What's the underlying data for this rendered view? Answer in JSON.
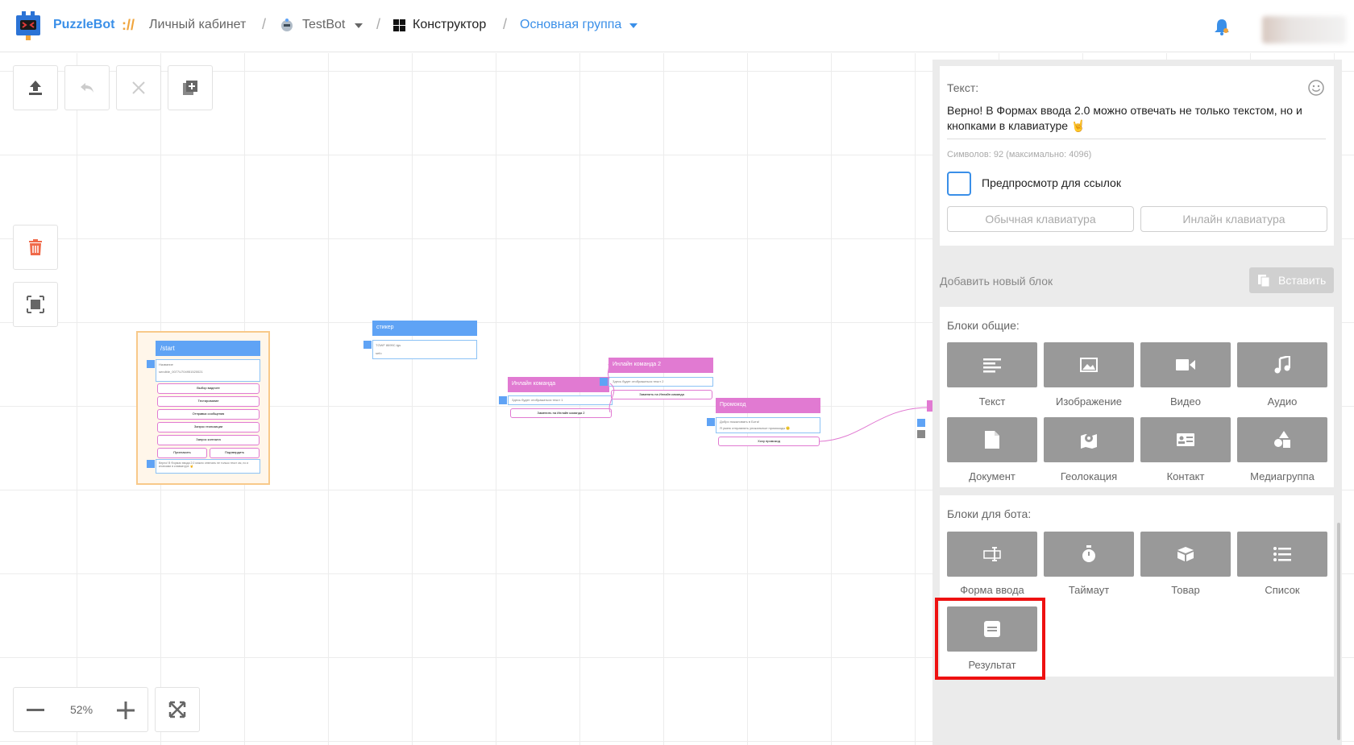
{
  "header": {
    "brand": "PuzzleBot",
    "brand_sep": "://",
    "crumbs": {
      "cabinet": "Личный кабинет",
      "bot": "TestBot",
      "constructor": "Конструктор",
      "group": "Основная группа"
    },
    "icons": [
      "puzzlebot-logo-icon",
      "bot-icon",
      "chevron-down-icon",
      "grid-icon",
      "bell-icon"
    ]
  },
  "toolbar": {
    "icons": [
      "upload-icon",
      "undo-icon",
      "close-icon",
      "add-box-icon",
      "trash-icon",
      "fit-select-icon",
      "minus-icon",
      "plus-icon",
      "fullscreen-icon"
    ]
  },
  "zoom": {
    "value": "52%"
  },
  "canvas_nodes": {
    "start": {
      "title": "/start",
      "intro_line1": "Название",
      "intro_line2": "sendble_0077U704951520021",
      "buttons": [
        "Выбор видеоте",
        "Тестирование",
        "Отправка сообщения",
        "Запрос геопозиции",
        "Запрос контакта"
      ],
      "button_left": "Пригласить",
      "button_right": "Подтвердить",
      "footer_text": "Верно! В Формах ввода 2.0 можно отвечать не только текст ом, но и кнопками в клавиатуре 🤘"
    },
    "sticker": {
      "title": "стикер",
      "line1": "TGWF 8699C.tgs",
      "line2": "sefo"
    },
    "inline1": {
      "title": "Инлайн команда",
      "text": "Здесь будет отображаться текст 1",
      "button": "Заменить на Инлайн команда 2"
    },
    "inline2": {
      "title": "Инлайн команда 2",
      "text": "Здесь будет отображаться текст 2",
      "button": "Заменить на Инлайн команда"
    },
    "promo": {
      "title": "Промокод",
      "line1": "Добро пожаловать в Бота!",
      "line2": "Я умею отправлять уникальные промокоды 🙂",
      "button": "Хочу промокод"
    }
  },
  "panel": {
    "text_label": "Текст:",
    "text_value": "Верно! В Формах ввода 2.0 можно отвечать не только текстом, но и кнопками в клавиатуре 🤘",
    "symbols": "Символов: 92 (максимально: 4096)",
    "preview_label": "Предпросмотр для ссылок",
    "kb_regular": "Обычная клавиатура",
    "kb_inline": "Инлайн клавиатура",
    "add_block": "Добавить новый блок",
    "paste": "Вставить",
    "general_title": "Блоки общие:",
    "general_blocks": [
      {
        "label": "Текст",
        "icon": "text-lines-icon"
      },
      {
        "label": "Изображение",
        "icon": "image-icon"
      },
      {
        "label": "Видео",
        "icon": "video-icon"
      },
      {
        "label": "Аудио",
        "icon": "music-note-icon"
      },
      {
        "label": "Документ",
        "icon": "document-icon"
      },
      {
        "label": "Геолокация",
        "icon": "map-pin-icon"
      },
      {
        "label": "Контакт",
        "icon": "contact-card-icon"
      },
      {
        "label": "Медиагруппа",
        "icon": "shapes-icon"
      }
    ],
    "bot_title": "Блоки для бота:",
    "bot_blocks": [
      {
        "label": "Форма ввода",
        "icon": "input-form-icon"
      },
      {
        "label": "Таймаут",
        "icon": "stopwatch-icon"
      },
      {
        "label": "Товар",
        "icon": "box-icon"
      },
      {
        "label": "Список",
        "icon": "list-icon"
      },
      {
        "label": "Результат",
        "icon": "result-icon"
      }
    ],
    "highlight_color": "#ee1111"
  },
  "colors": {
    "brand_blue": "#3a8fe8",
    "node_blue": "#5fa3f5",
    "node_pink": "#e17ad2",
    "block_gray": "#999999"
  }
}
